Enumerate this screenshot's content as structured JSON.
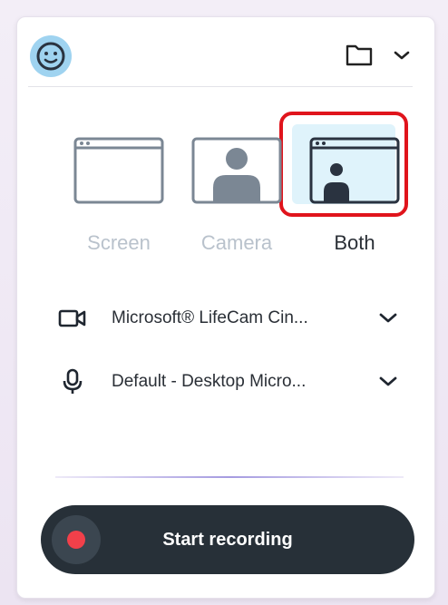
{
  "header": {
    "avatar_icon": "smiley-face-icon",
    "folder_icon": "folder-icon",
    "menu_icon": "chevron-down-icon"
  },
  "modes": [
    {
      "label": "Screen",
      "icon": "browser-window-icon",
      "selected": false
    },
    {
      "label": "Camera",
      "icon": "person-camera-icon",
      "selected": false
    },
    {
      "label": "Both",
      "icon": "window-with-person-icon",
      "selected": true
    }
  ],
  "devices": {
    "camera": {
      "icon": "video-camera-icon",
      "value": "Microsoft® LifeCam Cin..."
    },
    "microphone": {
      "icon": "microphone-icon",
      "value": "Default - Desktop Micro..."
    }
  },
  "record": {
    "label": "Start recording"
  },
  "colors": {
    "accent_dark": "#273038",
    "record_dot": "#f2404a",
    "highlight_border": "#e0141c",
    "selected_tint": "#dff3fb",
    "avatar": "#9fd3f0"
  }
}
